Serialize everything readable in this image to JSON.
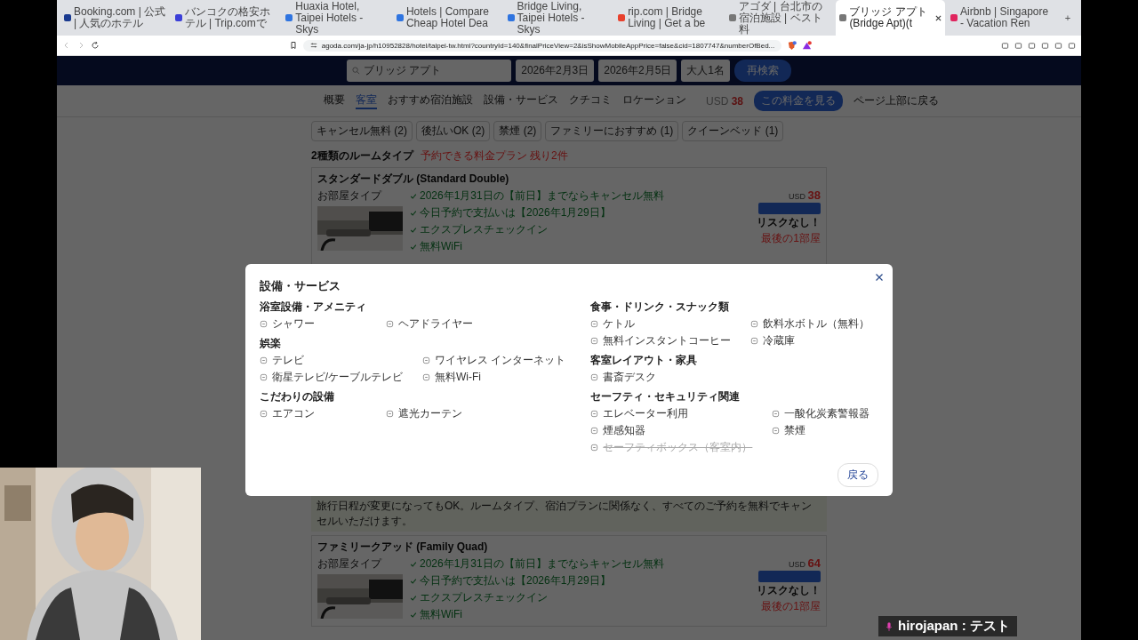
{
  "browser": {
    "tabs": [
      {
        "title": "Booking.com | 公式 | 人気のホテル",
        "selected": false,
        "color": "#1a3a8f"
      },
      {
        "title": "バンコクの格安ホテル | Trip.comで",
        "selected": false,
        "color": "#3b3fd8"
      },
      {
        "title": "Huaxia Hotel, Taipei Hotels - Skys",
        "selected": false,
        "color": "#2f74e0"
      },
      {
        "title": "Hotels | Compare Cheap Hotel Dea",
        "selected": false,
        "color": "#2f74e0"
      },
      {
        "title": "Bridge Living, Taipei Hotels - Skys",
        "selected": false,
        "color": "#2f74e0"
      },
      {
        "title": "rip.com | Bridge Living | Get a be",
        "selected": false,
        "color": "#e8412d"
      },
      {
        "title": "アゴダ | 台北市の宿泊施設 | ベスト料",
        "selected": false,
        "color": "#777777"
      },
      {
        "title": "ブリッジ アプト (Bridge Apt)(t",
        "selected": true,
        "color": "#777777"
      },
      {
        "title": "Airbnb | Singapore - Vacation Ren",
        "selected": false,
        "color": "#e0245e"
      }
    ],
    "new_tab": "+",
    "url": "agoda.com/ja-jp/h10952828/hotel/taipei-tw.html?countryId=140&finalPriceView=2&isShowMobileAppPrice=false&cid=1807747&numberOfBed..."
  },
  "search_bar": {
    "destination": "ブリッジ アプト",
    "check_in": "2026年2月3日",
    "check_out": "2026年2月5日",
    "guests": "大人1名",
    "button": "再検索"
  },
  "nav": {
    "items": [
      {
        "label": "概要",
        "selected": false
      },
      {
        "label": "客室",
        "selected": true
      },
      {
        "label": "おすすめ宿泊施設",
        "selected": false
      },
      {
        "label": "設備・サービス",
        "selected": false
      },
      {
        "label": "クチコミ",
        "selected": false
      },
      {
        "label": "ロケーション",
        "selected": false
      }
    ],
    "currency": "USD",
    "price": "38",
    "button": "この料金を見る",
    "back_to_top": "ページ上部に戻る"
  },
  "filters": [
    "キャンセル無料 (2)",
    "後払いOK (2)",
    "禁煙 (2)",
    "ファミリーにおすすめ (1)",
    "クイーンベッド (1)"
  ],
  "room_summary": {
    "title": "2種類のルームタイプ",
    "availability": "予約できる料金プラン 残り2件"
  },
  "rooms": [
    {
      "name": "スタンダードダブル (Standard Double)",
      "type_label": "お部屋タイプ",
      "benefits": [
        "2026年1月31日の【前日】までならキャンセル無料",
        "今日予約で支払いは【2026年1月29日】",
        "エクスプレスチェックイン",
        "無料WiFi"
      ],
      "currency": "USD",
      "price": "38",
      "note": "リスクなし！",
      "scarcity": "最後の1部屋"
    },
    {
      "name": "ファミリークアッド (Family Quad)",
      "type_label": "お部屋タイプ",
      "benefits": [
        "2026年1月31日の【前日】までならキャンセル無料",
        "今日予約で支払いは【2026年1月29日】",
        "エクスプレスチェックイン",
        "無料WiFi"
      ],
      "currency": "USD",
      "price": "64",
      "note": "リスクなし！",
      "scarcity": "最後の1部屋"
    }
  ],
  "cancel_notice": "旅行日程が変更になってもOK。ルームタイプ、宿泊プランに関係なく、すべてのご予約を無料でキャンセルいただけます。",
  "modal": {
    "title": "設備・サービス",
    "columns": [
      [
        {
          "title": "浴室設備・アメニティ",
          "items": [
            {
              "label": "シャワー",
              "available": true
            },
            {
              "label": "ヘアドライヤー",
              "available": true
            }
          ]
        },
        {
          "title": "娯楽",
          "items": [
            {
              "label": "テレビ",
              "available": true
            },
            {
              "label": "ワイヤレス インターネット",
              "available": true
            },
            {
              "label": "衛星テレビ/ケーブルテレビ",
              "available": true
            },
            {
              "label": "無料Wi-Fi",
              "available": true
            }
          ]
        },
        {
          "title": "こだわりの設備",
          "items": [
            {
              "label": "エアコン",
              "available": true
            },
            {
              "label": "遮光カーテン",
              "available": true
            }
          ]
        }
      ],
      [
        {
          "title": "食事・ドリンク・スナック類",
          "items": [
            {
              "label": "ケトル",
              "available": true
            },
            {
              "label": "飲料水ボトル（無料）",
              "available": true
            },
            {
              "label": "無料インスタントコーヒー",
              "available": true
            },
            {
              "label": "冷蔵庫",
              "available": true
            }
          ]
        },
        {
          "title": "客室レイアウト・家具",
          "items": [
            {
              "label": "書斎デスク",
              "available": true
            }
          ]
        },
        {
          "title": "セーフティ・セキュリティ関連",
          "items": [
            {
              "label": "エレベーター利用",
              "available": true
            },
            {
              "label": "一酸化炭素警報器",
              "available": true
            },
            {
              "label": "煙感知器",
              "available": true
            },
            {
              "label": "禁煙",
              "available": true
            },
            {
              "label": "セーフティボックス（客室内）",
              "available": false
            }
          ]
        }
      ]
    ],
    "back_button": "戻る"
  },
  "caption": "hirojapan : テスト"
}
